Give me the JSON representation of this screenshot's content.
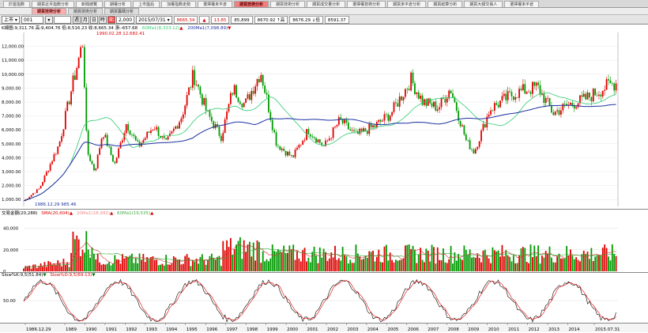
{
  "tabs_row1": [
    "於盤指數",
    "期貨近月指數分析",
    "新聞總覽",
    "期權分析",
    "上市盤后",
    "加權指數走勢",
    "選擇權未平倉",
    "期貨技術分析",
    "期貨技術分析",
    "期貨成交量分析",
    "選擇權技術分析",
    "期貨未平倉分析",
    "期貨結算分析",
    "期貨大額交易人",
    "選擇權未平倉"
  ],
  "tabs_row1_active": 7,
  "tabs_row2": [
    "期貨技術分析",
    "期貨技術分析",
    "期貨籌碼分析"
  ],
  "tabs_row2_active": 0,
  "toolbar": {
    "market": "上市",
    "code": "001",
    "icons": [
      "週",
      "月",
      "日",
      "時"
    ],
    "period_label": "期",
    "count": "2,000",
    "date": "2015/07/31",
    "quote": [
      {
        "text": "8665.34",
        "cls": "up"
      },
      {
        "text": "▲",
        "cls": "up"
      },
      {
        "text": "13.85",
        "cls": "up"
      },
      {
        "text": "85,899",
        "cls": ""
      },
      {
        "text": "8670.92 ↑高",
        "cls": ""
      },
      {
        "text": "8676.29 ↓低",
        "cls": ""
      },
      {
        "text": "8591.37",
        "cls": ""
      }
    ]
  },
  "price_panel": {
    "header": "K線圖:9,311.76 高:9,404.76 低:8,516.23 收:8,665.34 漲:-657.68",
    "ma1": "60Ma1(8,333.12)",
    "ma2": "200Ma1(7,098.89)",
    "peak_label": "1990.02.28 12,682.41",
    "low_label": "1986.12.29 985.46",
    "y_ticks": [
      "12,000.00",
      "11,000.00",
      "10,000.00",
      "9,000.00",
      "8,000.00",
      "7,000.00",
      "6,000.00",
      "5,000.00",
      "4,000.00",
      "3,000.00",
      "2,000.00",
      "1,000.00"
    ]
  },
  "volume_panel": {
    "header": "交易金額(20,288)",
    "sma": "SMA(20,604)",
    "ma20": "20Ma1(18,992)",
    "ma60": "60Ma1(19,535)",
    "y_ticks": [
      "40,000",
      "20,000",
      "0"
    ]
  },
  "kd_panel": {
    "k": "Slow%K:9,5(51.84)",
    "d": "Slow%D:9,5(69.13)",
    "y_ticks": [
      "50.00"
    ]
  },
  "x_axis": [
    "1986.12.29",
    "1989",
    "1990",
    "1991",
    "1992",
    "1993",
    "1994",
    "1995",
    "1996",
    "1997",
    "1998",
    "1999",
    "2000",
    "2001",
    "2002",
    "2003",
    "2004",
    "2005",
    "2006",
    "2007",
    "2008",
    "2009",
    "2010",
    "2011",
    "2012",
    "2013",
    "2014",
    "2015.07.31"
  ],
  "colors": {
    "up": "#e00000",
    "down": "#009900",
    "ma60": "#2ecc71",
    "ma200": "#1a2fa0",
    "k": "#000000",
    "d": "#e00000"
  }
}
